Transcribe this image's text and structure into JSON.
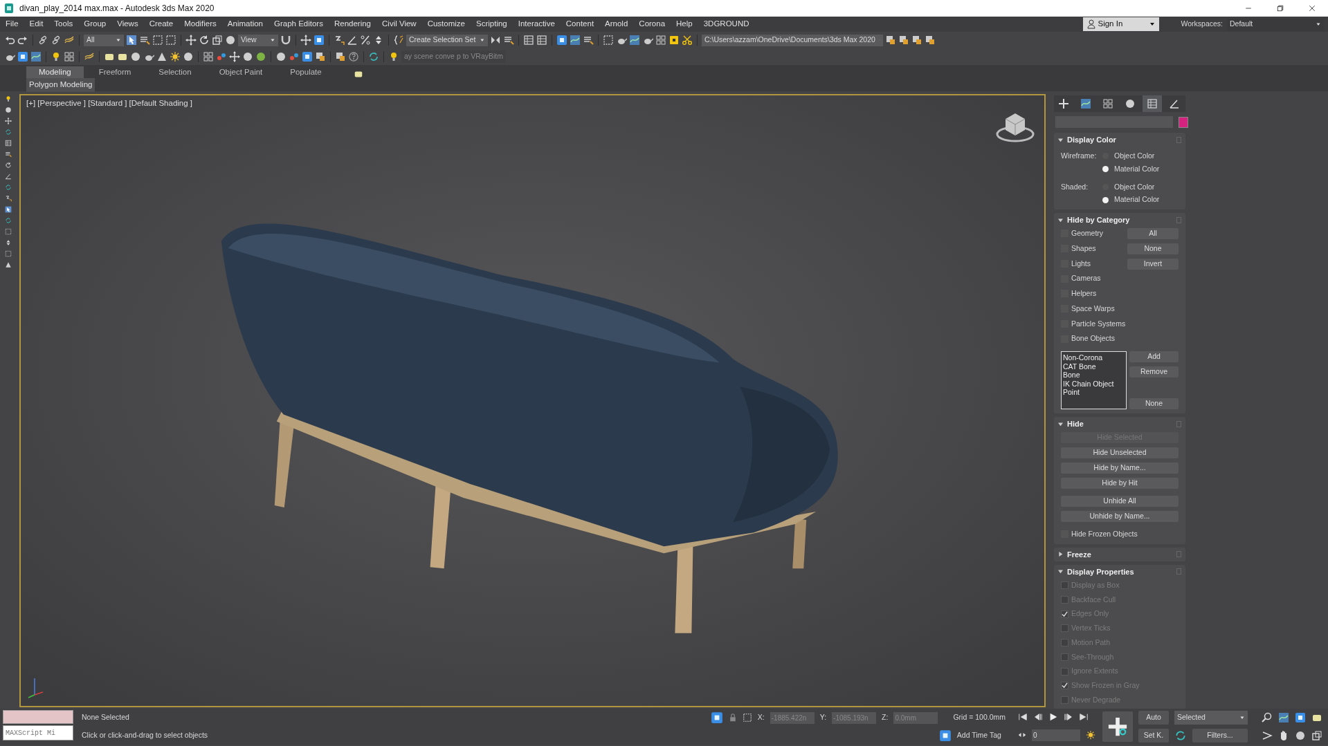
{
  "window": {
    "title": "divan_play_2014 max.max - Autodesk 3ds Max 2020"
  },
  "menu": [
    "File",
    "Edit",
    "Tools",
    "Group",
    "Views",
    "Create",
    "Modifiers",
    "Animation",
    "Graph Editors",
    "Rendering",
    "Civil View",
    "Customize",
    "Scripting",
    "Interactive",
    "Content",
    "Arnold",
    "Corona",
    "Help",
    "3DGROUND"
  ],
  "account": {
    "sign_in": "Sign In",
    "workspaces_label": "Workspaces:",
    "workspace": "Default"
  },
  "toolbar": {
    "selection_filter": "All",
    "reference_coordinates": "View",
    "selection_set": "Create Selection Set",
    "project_path": "C:\\Users\\azzam\\OneDrive\\Documents\\3ds Max 2020",
    "hint": "ay scene conve p to VRayBitm"
  },
  "ribbon": {
    "tabs": [
      {
        "label": "Modeling",
        "selected": true
      },
      {
        "label": "Freeform",
        "selected": false
      },
      {
        "label": "Selection",
        "selected": false
      },
      {
        "label": "Object Paint",
        "selected": false
      },
      {
        "label": "Populate",
        "selected": false
      }
    ],
    "panel": "Polygon Modeling"
  },
  "viewport": {
    "label": "[+] [Perspective ] [Standard ] [Default Shading ]",
    "active": true
  },
  "command_panel": {
    "tabs": [
      {
        "kind": "create",
        "selected": false
      },
      {
        "kind": "modify",
        "selected": false
      },
      {
        "kind": "hierarchy",
        "selected": false
      },
      {
        "kind": "motion",
        "selected": false
      },
      {
        "kind": "display",
        "selected": true
      },
      {
        "kind": "utilities",
        "selected": false
      }
    ],
    "rollouts": [
      {
        "kind": "display_color",
        "title": "Display Color",
        "expanded": true,
        "groups": [
          {
            "label": "Wireframe:",
            "options": [
              {
                "label": "Object Color",
                "selected": false
              },
              {
                "label": "Material Color",
                "selected": true
              }
            ]
          },
          {
            "label": "Shaded:",
            "options": [
              {
                "label": "Object Color",
                "selected": false
              },
              {
                "label": "Material Color",
                "selected": true
              }
            ]
          }
        ]
      },
      {
        "kind": "hide_by_category",
        "title": "Hide by Category",
        "expanded": true,
        "checks": [
          {
            "label": "Geometry",
            "checked": false
          },
          {
            "label": "Shapes",
            "checked": false
          },
          {
            "label": "Lights",
            "checked": false
          },
          {
            "label": "Cameras",
            "checked": false
          },
          {
            "label": "Helpers",
            "checked": false
          },
          {
            "label": "Space Warps",
            "checked": false
          },
          {
            "label": "Particle Systems",
            "checked": false
          },
          {
            "label": "Bone Objects",
            "checked": false
          }
        ],
        "buttons": [
          "All",
          "None",
          "Invert"
        ],
        "list": [
          "Non-Corona",
          "CAT Bone",
          "Bone",
          "IK Chain Object",
          "Point"
        ],
        "list_buttons": [
          "Add",
          "Remove",
          "None"
        ]
      },
      {
        "kind": "hide",
        "title": "Hide",
        "expanded": true,
        "button_groups": [
          [
            {
              "label": "Hide Selected",
              "disabled": true
            },
            {
              "label": "Hide Unselected",
              "disabled": false
            },
            {
              "label": "Hide by Name...",
              "disabled": false
            },
            {
              "label": "Hide by Hit",
              "disabled": false
            }
          ],
          [
            {
              "label": "Unhide All",
              "disabled": false
            },
            {
              "label": "Unhide by Name...",
              "disabled": false
            }
          ]
        ],
        "check": {
          "label": "Hide Frozen Objects",
          "checked": false
        }
      },
      {
        "kind": "freeze",
        "title": "Freeze",
        "expanded": false
      },
      {
        "kind": "display_properties",
        "title": "Display Properties",
        "expanded": true,
        "checks": [
          {
            "label": "Display as Box",
            "checked": false,
            "disabled": true
          },
          {
            "label": "Backface Cull",
            "checked": false,
            "disabled": true
          },
          {
            "label": "Edges Only",
            "checked": true,
            "disabled": true
          },
          {
            "label": "Vertex Ticks",
            "checked": false,
            "disabled": true
          },
          {
            "label": "Motion Path",
            "checked": false,
            "disabled": true
          },
          {
            "label": "See-Through",
            "checked": false,
            "disabled": true
          },
          {
            "label": "Ignore Extents",
            "checked": false,
            "disabled": true
          },
          {
            "label": "Show Frozen in Gray",
            "checked": true,
            "disabled": true
          },
          {
            "label": "Never Degrade",
            "checked": false,
            "disabled": true
          }
        ]
      }
    ]
  },
  "status_bar": {
    "listener_placeholder": "MAXScript Mi",
    "selection": "None Selected",
    "prompt": "Click or click-and-drag to select objects",
    "x_label": "X:",
    "x": "-1885.422n",
    "y_label": "Y:",
    "y": "-1085.193n",
    "z_label": "Z:",
    "z": "0.0mm",
    "grid": "Grid = 100.0mm",
    "time_tag": "Add Time Tag",
    "frame": "0",
    "auto_key": "Auto",
    "set_key": "Set K.",
    "key_filter": "Selected",
    "filters": "Filters..."
  }
}
